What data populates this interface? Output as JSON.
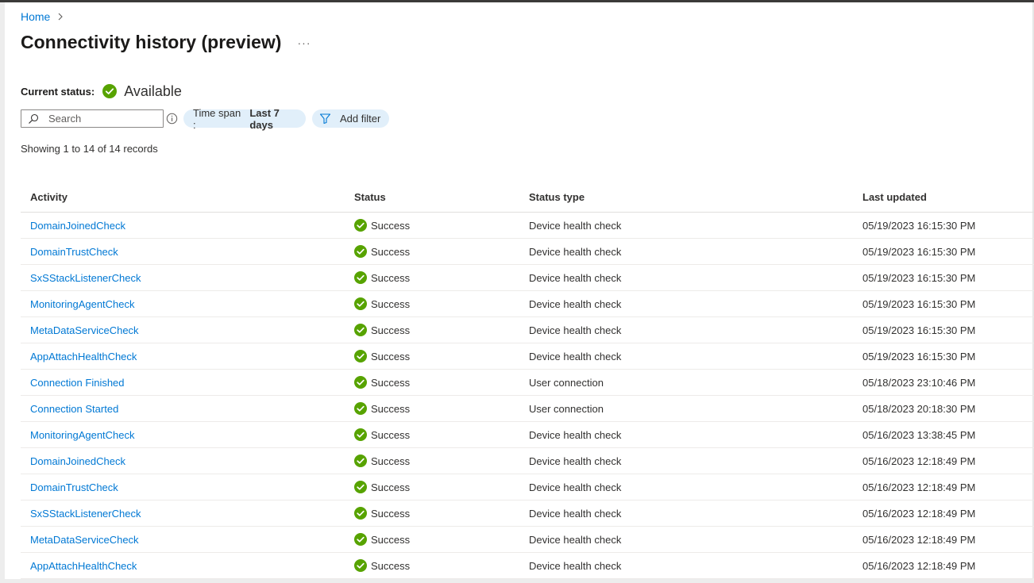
{
  "breadcrumb": {
    "home": "Home"
  },
  "page": {
    "title": "Connectivity history (preview)",
    "more": "···"
  },
  "current_status": {
    "label": "Current status:",
    "value": "Available"
  },
  "search": {
    "placeholder": "Search",
    "value": ""
  },
  "filters": {
    "time_span_label": "Time span : ",
    "time_span_value": "Last 7 days",
    "add_filter": "Add filter"
  },
  "records_text": "Showing 1 to 14 of 14 records",
  "table": {
    "columns": [
      "Activity",
      "Status",
      "Status type",
      "Last updated"
    ],
    "rows": [
      {
        "activity": "DomainJoinedCheck",
        "status": "Success",
        "type": "Device health check",
        "updated": "05/19/2023 16:15:30 PM"
      },
      {
        "activity": "DomainTrustCheck",
        "status": "Success",
        "type": "Device health check",
        "updated": "05/19/2023 16:15:30 PM"
      },
      {
        "activity": "SxSStackListenerCheck",
        "status": "Success",
        "type": "Device health check",
        "updated": "05/19/2023 16:15:30 PM"
      },
      {
        "activity": "MonitoringAgentCheck",
        "status": "Success",
        "type": "Device health check",
        "updated": "05/19/2023 16:15:30 PM"
      },
      {
        "activity": "MetaDataServiceCheck",
        "status": "Success",
        "type": "Device health check",
        "updated": "05/19/2023 16:15:30 PM"
      },
      {
        "activity": "AppAttachHealthCheck",
        "status": "Success",
        "type": "Device health check",
        "updated": "05/19/2023 16:15:30 PM"
      },
      {
        "activity": "Connection Finished",
        "status": "Success",
        "type": "User connection",
        "updated": "05/18/2023 23:10:46 PM"
      },
      {
        "activity": "Connection Started",
        "status": "Success",
        "type": "User connection",
        "updated": "05/18/2023 20:18:30 PM"
      },
      {
        "activity": "MonitoringAgentCheck",
        "status": "Success",
        "type": "Device health check",
        "updated": "05/16/2023 13:38:45 PM"
      },
      {
        "activity": "DomainJoinedCheck",
        "status": "Success",
        "type": "Device health check",
        "updated": "05/16/2023 12:18:49 PM"
      },
      {
        "activity": "DomainTrustCheck",
        "status": "Success",
        "type": "Device health check",
        "updated": "05/16/2023 12:18:49 PM"
      },
      {
        "activity": "SxSStackListenerCheck",
        "status": "Success",
        "type": "Device health check",
        "updated": "05/16/2023 12:18:49 PM"
      },
      {
        "activity": "MetaDataServiceCheck",
        "status": "Success",
        "type": "Device health check",
        "updated": "05/16/2023 12:18:49 PM"
      },
      {
        "activity": "AppAttachHealthCheck",
        "status": "Success",
        "type": "Device health check",
        "updated": "05/16/2023 12:18:49 PM"
      }
    ]
  },
  "colors": {
    "link": "#0078d4",
    "success": "#57a300",
    "pill_bg": "#e1effa"
  },
  "icons": {
    "status": "success-check-icon",
    "search": "search-icon",
    "info": "info-icon",
    "filter": "filter-icon",
    "chevron": "chevron-right-icon"
  }
}
